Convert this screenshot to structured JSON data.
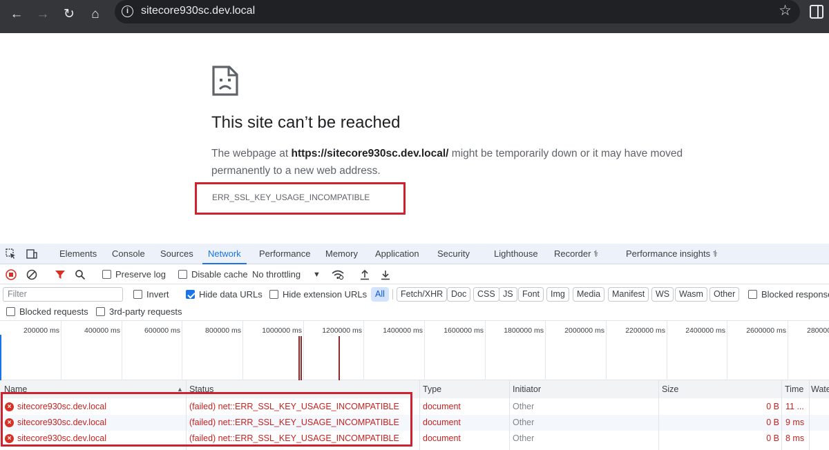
{
  "browser": {
    "url": "sitecore930sc.dev.local",
    "icons": [
      "back-icon",
      "forward-icon",
      "reload-icon",
      "home-icon",
      "info-icon",
      "star-icon",
      "side-panel-icon"
    ]
  },
  "error_page": {
    "title": "This site can’t be reached",
    "body_prefix": "The webpage at ",
    "body_url": "https://sitecore930sc.dev.local/",
    "body_suffix": " might be temporarily down or it may have moved permanently to a new web address.",
    "error_code": "ERR_SSL_KEY_USAGE_INCOMPATIBLE"
  },
  "devtools": {
    "tabs": [
      "Elements",
      "Console",
      "Sources",
      "Network",
      "Performance",
      "Memory",
      "Application",
      "Security",
      "Lighthouse",
      "Recorder",
      "Performance insights"
    ],
    "active_tab": "Network",
    "toolbar": {
      "preserve_log": "Preserve log",
      "disable_cache": "Disable cache",
      "throttling": "No throttling"
    },
    "filter": {
      "placeholder": "Filter",
      "invert": "Invert",
      "hide_data_urls": "Hide data URLs",
      "hide_extension_urls": "Hide extension URLs",
      "types": [
        "All",
        "Fetch/XHR",
        "Doc",
        "CSS",
        "JS",
        "Font",
        "Img",
        "Media",
        "Manifest",
        "WS",
        "Wasm",
        "Other"
      ],
      "blocked_response": "Blocked response",
      "blocked_requests": "Blocked requests",
      "third_party": "3rd-party requests"
    },
    "timeline_ticks": [
      "200000 ms",
      "400000 ms",
      "600000 ms",
      "800000 ms",
      "1000000 ms",
      "1200000 ms",
      "1400000 ms",
      "1600000 ms",
      "1800000 ms",
      "2000000 ms",
      "2200000 ms",
      "2400000 ms",
      "2600000 ms",
      "280000"
    ],
    "columns": [
      "Name",
      "Status",
      "Type",
      "Initiator",
      "Size",
      "Time",
      "Wate"
    ],
    "rows": [
      {
        "name": "sitecore930sc.dev.local",
        "status": "(failed) net::ERR_SSL_KEY_USAGE_INCOMPATIBLE",
        "type": "document",
        "initiator": "Other",
        "size": "0 B",
        "time": "11 ..."
      },
      {
        "name": "sitecore930sc.dev.local",
        "status": "(failed) net::ERR_SSL_KEY_USAGE_INCOMPATIBLE",
        "type": "document",
        "initiator": "Other",
        "size": "0 B",
        "time": "9 ms"
      },
      {
        "name": "sitecore930sc.dev.local",
        "status": "(failed) net::ERR_SSL_KEY_USAGE_INCOMPATIBLE",
        "type": "document",
        "initiator": "Other",
        "size": "0 B",
        "time": "8 ms"
      }
    ]
  },
  "colors": {
    "highlight_box": "#d0212f",
    "accent": "#1a73e8",
    "error": "#c5221f"
  }
}
